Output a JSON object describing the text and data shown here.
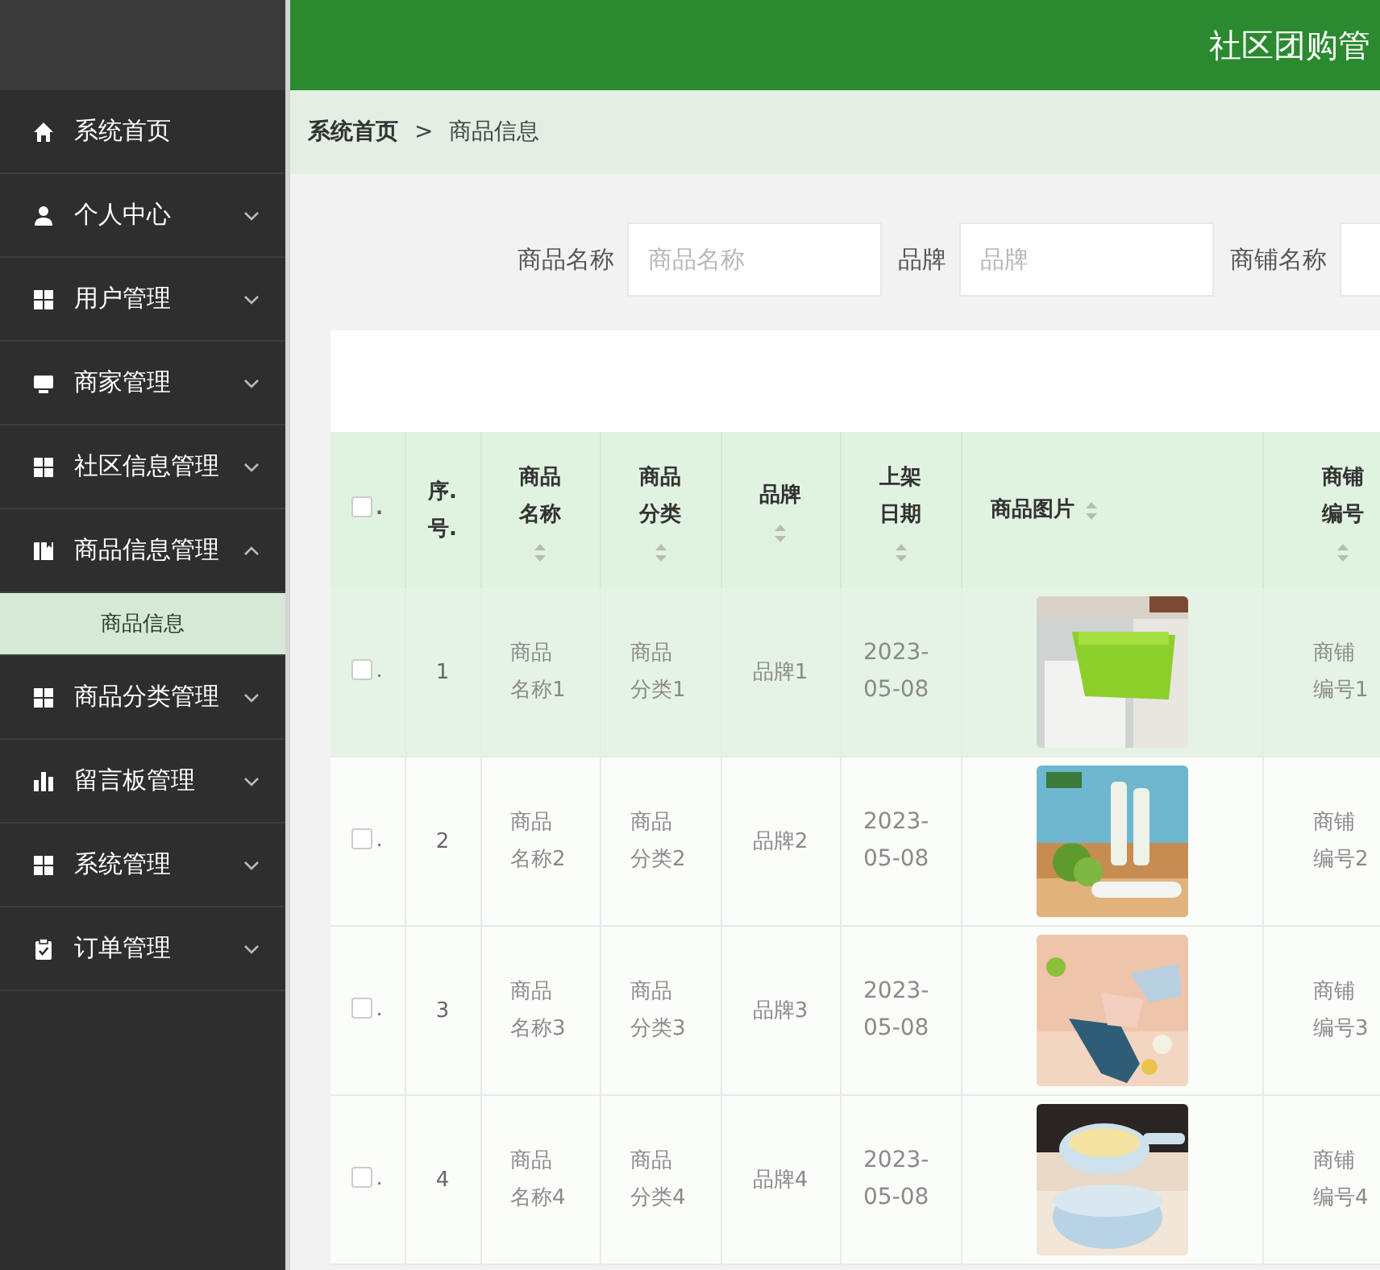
{
  "header": {
    "title": "社区团购管"
  },
  "sidebar": {
    "items": [
      {
        "label": "系统首页"
      },
      {
        "label": "个人中心",
        "expanded": false
      },
      {
        "label": "用户管理",
        "expanded": false
      },
      {
        "label": "商家管理",
        "expanded": false
      },
      {
        "label": "社区信息管理",
        "expanded": false
      },
      {
        "label": "商品信息管理",
        "expanded": true,
        "children": [
          {
            "label": "商品信息",
            "selected": true
          }
        ]
      },
      {
        "label": "商品分类管理",
        "expanded": false
      },
      {
        "label": "留言板管理",
        "expanded": false
      },
      {
        "label": "系统管理",
        "expanded": false
      },
      {
        "label": "订单管理",
        "expanded": false
      }
    ]
  },
  "breadcrumb": [
    {
      "label": "系统首页"
    },
    {
      "label": ">"
    },
    {
      "label": "商品信息"
    }
  ],
  "search": [
    {
      "label": "商品名称",
      "placeholder": "商品名称"
    },
    {
      "label": "品牌",
      "placeholder": "品牌"
    },
    {
      "label": "商铺名称"
    }
  ],
  "table": {
    "header_check": {
      "checked": false,
      "label": "."
    },
    "columns": [
      {
        "label": "序.号.",
        "sortable": false
      },
      {
        "label": "商品名称",
        "sortable": true
      },
      {
        "label": "商品分类",
        "sortable": true
      },
      {
        "label": "品牌",
        "sortable": true
      },
      {
        "label": "上架日期",
        "sortable": true
      },
      {
        "label": "商品图片",
        "sortable": true
      },
      {
        "label": "商铺编号",
        "sortable": true
      }
    ],
    "rows": [
      {
        "checked": false,
        "check_label": ".",
        "highlighted": true,
        "cells": [
          "1",
          "商品名称1",
          "商品分类1",
          "品牌1",
          "2023-05-08",
          "",
          "商铺编号1"
        ]
      },
      {
        "checked": false,
        "check_label": ".",
        "highlighted": false,
        "cells": [
          "2",
          "商品名称2",
          "商品分类2",
          "品牌2",
          "2023-05-08",
          "",
          "商铺编号2"
        ]
      },
      {
        "checked": false,
        "check_label": ".",
        "highlighted": false,
        "cells": [
          "3",
          "商品名称3",
          "商品分类3",
          "品牌3",
          "2023-05-08",
          "",
          "商铺编号3"
        ]
      },
      {
        "checked": false,
        "check_label": ".",
        "highlighted": false,
        "cells": [
          "4",
          "商品名称4",
          "商品分类4",
          "品牌4",
          "2023-05-08",
          "",
          "商铺编号4"
        ]
      }
    ]
  }
}
